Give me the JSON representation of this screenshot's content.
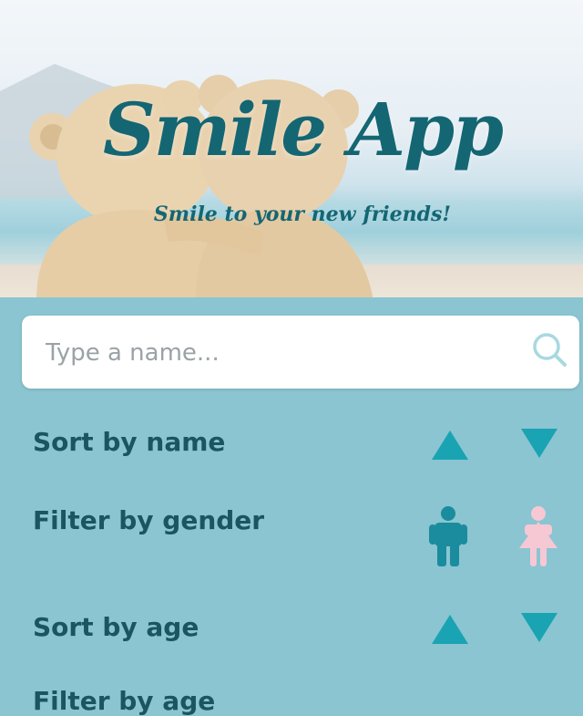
{
  "header": {
    "title": "Smile App",
    "subtitle": "Smile to your new friends!"
  },
  "search": {
    "placeholder": "Type a name...",
    "value": "",
    "icon": "search-icon"
  },
  "controls": {
    "sort_name_label": "Sort by name",
    "filter_gender_label": "Filter by gender",
    "sort_age_label": "Sort by age",
    "next_label_partial": "Filter by age"
  },
  "colors": {
    "brand_dark": "#146673",
    "panel_bg": "#8ac5d1",
    "accent_teal": "#1aa3b3",
    "male_icon": "#1a8c9e",
    "female_icon": "#f6c8d4"
  }
}
